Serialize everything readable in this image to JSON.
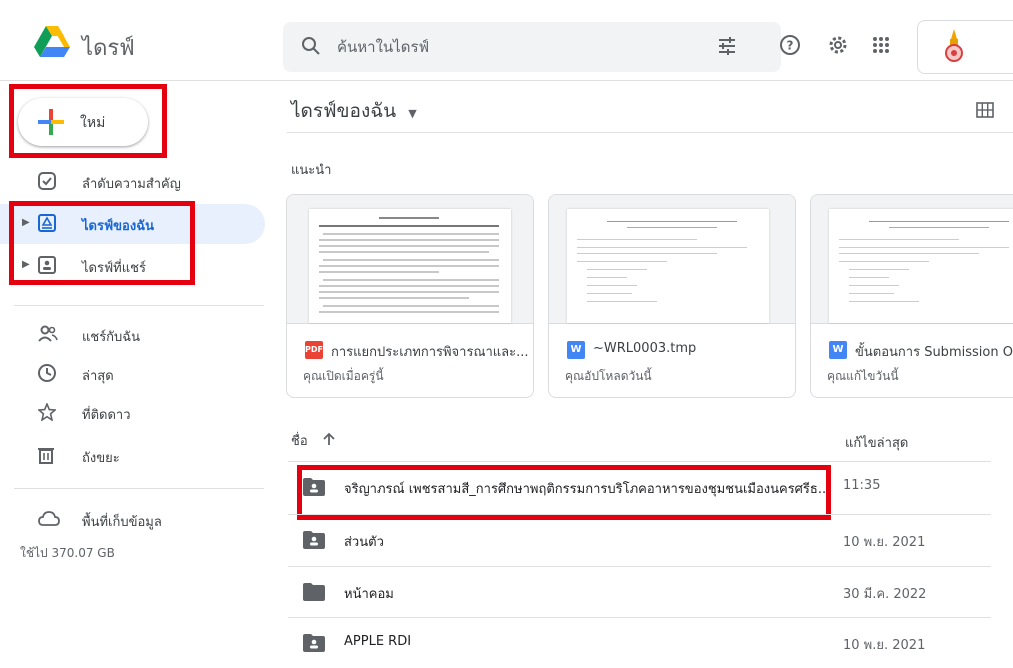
{
  "app": {
    "title": "ไดรฟ์"
  },
  "search": {
    "placeholder": "ค้นหาในไดรฟ์"
  },
  "sidebar": {
    "new_label": "ใหม่",
    "items": [
      {
        "label": "ลำดับความสำคัญ",
        "icon": "priority-check-icon"
      },
      {
        "label": "ไดรฟ์ของฉัน",
        "icon": "my-drive-icon",
        "selected": true
      },
      {
        "label": "ไดรฟ์ที่แชร์",
        "icon": "shared-drives-icon"
      },
      {
        "label": "แชร์กับฉัน",
        "icon": "people-icon"
      },
      {
        "label": "ล่าสุด",
        "icon": "clock-icon"
      },
      {
        "label": "ที่ติดดาว",
        "icon": "star-icon"
      },
      {
        "label": "ถังขยะ",
        "icon": "trash-icon"
      },
      {
        "label": "พื้นที่เก็บข้อมูล",
        "icon": "cloud-icon"
      }
    ],
    "storage_used": "ใช้ไป 370.07 GB"
  },
  "main": {
    "breadcrumb": "ไดรฟ์ของฉัน",
    "suggested_label": "แนะนำ",
    "cards": [
      {
        "name": "การแยกประเภทการพิจารณาและ...",
        "sub": "คุณเปิดเมื่อครู่นี้",
        "type": "PDF",
        "color": "#ea4335"
      },
      {
        "name": "~WRL0003.tmp",
        "sub": "คุณอัปโหลดวันนี้",
        "type": "W",
        "color": "#4285f4"
      },
      {
        "name": "ขั้นตอนการ Submission Or",
        "sub": "คุณแก้ไขวันนี้",
        "type": "W",
        "color": "#4285f4"
      }
    ],
    "table": {
      "col_name": "ชื่อ",
      "col_modified": "แก้ไขล่าสุด",
      "rows": [
        {
          "name": "จริญาภรณ์ เพชรสามสี_การศึกษาพฤติกรรมการบริโภคอาหารของชุมชนเมืองนครศรีธ...",
          "modified": "11:35",
          "shared": true
        },
        {
          "name": "ส่วนตัว",
          "modified": "10 พ.ย. 2021",
          "shared": true
        },
        {
          "name": "หน้าคอม",
          "modified": "30 มี.ค. 2022",
          "shared": false
        },
        {
          "name": "APPLE RDI",
          "modified": "10 พ.ย. 2021",
          "shared": true
        }
      ]
    }
  },
  "colors": {
    "highlight": "#e4000f",
    "selected_bg": "#e8f0fe",
    "accent": "#1967d2"
  }
}
